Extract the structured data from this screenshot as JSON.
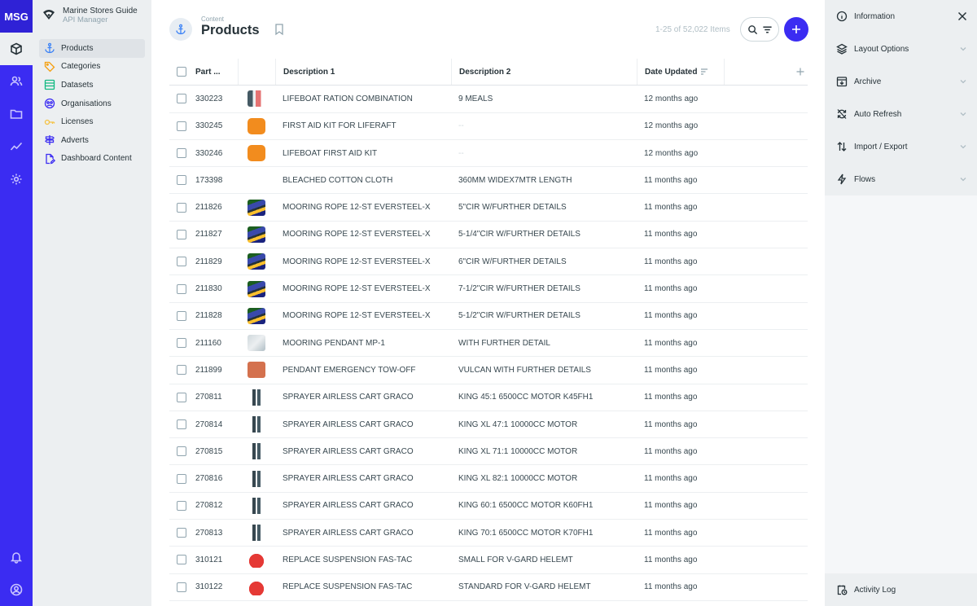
{
  "brand": {
    "logo": "MSG",
    "name": "Marine Stores Guide",
    "subtitle": "API Manager"
  },
  "nav": {
    "items": [
      {
        "label": "Products",
        "icon": "anchor-icon",
        "color": "#3b82f6"
      },
      {
        "label": "Categories",
        "icon": "tag-icon",
        "color": "#f59e0b"
      },
      {
        "label": "Datasets",
        "icon": "dataset-icon",
        "color": "#10b981"
      },
      {
        "label": "Organisations",
        "icon": "organisation-icon",
        "color": "#3b2cf2"
      },
      {
        "label": "Licenses",
        "icon": "key-icon",
        "color": "#f5c242"
      },
      {
        "label": "Adverts",
        "icon": "signpost-icon",
        "color": "#3b2cf2"
      },
      {
        "label": "Dashboard Content",
        "icon": "file-edit-icon",
        "color": "#3b2cf2"
      }
    ]
  },
  "header": {
    "breadcrumb": "Content",
    "title": "Products",
    "count": "1-25 of 52,022 Items"
  },
  "table": {
    "columns": {
      "part": "Part ...",
      "desc1": "Description 1",
      "desc2": "Description 2",
      "date": "Date Updated"
    },
    "rows": [
      {
        "part": "330223",
        "thumb": "multi",
        "desc1": "LIFEBOAT RATION COMBINATION",
        "desc2": "9 MEALS",
        "date": "12 months ago"
      },
      {
        "part": "330245",
        "thumb": "orange",
        "desc1": "FIRST AID KIT FOR LIFERAFT",
        "desc2": "--",
        "date": "12 months ago"
      },
      {
        "part": "330246",
        "thumb": "orange",
        "desc1": "LIFEBOAT FIRST AID KIT",
        "desc2": "--",
        "date": "12 months ago"
      },
      {
        "part": "173398",
        "thumb": "none",
        "desc1": "BLEACHED COTTON CLOTH",
        "desc2": "360MM WIDEX7MTR LENGTH",
        "date": "11 months ago"
      },
      {
        "part": "211826",
        "thumb": "blue",
        "desc1": "MOORING ROPE 12-ST EVERSTEEL-X",
        "desc2": "5\"CIR W/FURTHER DETAILS",
        "date": "11 months ago"
      },
      {
        "part": "211827",
        "thumb": "blue",
        "desc1": "MOORING ROPE 12-ST EVERSTEEL-X",
        "desc2": "5-1/4\"CIR W/FURTHER DETAILS",
        "date": "11 months ago"
      },
      {
        "part": "211829",
        "thumb": "blue",
        "desc1": "MOORING ROPE 12-ST EVERSTEEL-X",
        "desc2": "6\"CIR W/FURTHER DETAILS",
        "date": "11 months ago"
      },
      {
        "part": "211830",
        "thumb": "blue",
        "desc1": "MOORING ROPE 12-ST EVERSTEEL-X",
        "desc2": "7-1/2\"CIR W/FURTHER DETAILS",
        "date": "11 months ago"
      },
      {
        "part": "211828",
        "thumb": "blue",
        "desc1": "MOORING ROPE 12-ST EVERSTEEL-X",
        "desc2": "5-1/2\"CIR W/FURTHER DETAILS",
        "date": "11 months ago"
      },
      {
        "part": "211160",
        "thumb": "grey",
        "desc1": "MOORING PENDANT MP-1",
        "desc2": "WITH FURTHER DETAIL",
        "date": "11 months ago"
      },
      {
        "part": "211899",
        "thumb": "red",
        "desc1": "PENDANT EMERGENCY TOW-OFF",
        "desc2": "VULCAN WITH FURTHER DETAILS",
        "date": "11 months ago"
      },
      {
        "part": "270811",
        "thumb": "cart",
        "desc1": "SPRAYER AIRLESS CART GRACO",
        "desc2": "KING 45:1 6500CC MOTOR K45FH1",
        "date": "11 months ago"
      },
      {
        "part": "270814",
        "thumb": "cart",
        "desc1": "SPRAYER AIRLESS CART GRACO",
        "desc2": "KING XL 47:1 10000CC MOTOR",
        "date": "11 months ago"
      },
      {
        "part": "270815",
        "thumb": "cart",
        "desc1": "SPRAYER AIRLESS CART GRACO",
        "desc2": "KING XL 71:1 10000CC MOTOR",
        "date": "11 months ago"
      },
      {
        "part": "270816",
        "thumb": "cart",
        "desc1": "SPRAYER AIRLESS CART GRACO",
        "desc2": "KING XL 82:1 10000CC MOTOR",
        "date": "11 months ago"
      },
      {
        "part": "270812",
        "thumb": "cart",
        "desc1": "SPRAYER AIRLESS CART GRACO",
        "desc2": "KING 60:1 6500CC MOTOR K60FH1",
        "date": "11 months ago"
      },
      {
        "part": "270813",
        "thumb": "cart",
        "desc1": "SPRAYER AIRLESS CART GRACO",
        "desc2": "KING 70:1 6500CC MOTOR K70FH1",
        "date": "11 months ago"
      },
      {
        "part": "310121",
        "thumb": "helmet",
        "desc1": "REPLACE SUSPENSION FAS-TAC",
        "desc2": "SMALL FOR V-GARD HELEMT",
        "date": "11 months ago"
      },
      {
        "part": "310122",
        "thumb": "helmet",
        "desc1": "REPLACE SUSPENSION FAS-TAC",
        "desc2": "STANDARD FOR V-GARD HELEMT",
        "date": "11 months ago"
      }
    ]
  },
  "panel": {
    "sections": [
      {
        "label": "Information",
        "icon": "info-icon"
      },
      {
        "label": "Layout Options",
        "icon": "layers-icon"
      },
      {
        "label": "Archive",
        "icon": "archive-icon"
      },
      {
        "label": "Auto Refresh",
        "icon": "refresh-off-icon"
      },
      {
        "label": "Import / Export",
        "icon": "import-export-icon"
      },
      {
        "label": "Flows",
        "icon": "bolt-icon"
      }
    ],
    "activity": "Activity Log"
  },
  "colors": {
    "accent": "#3b2cf2",
    "panel": "#eceff1"
  }
}
